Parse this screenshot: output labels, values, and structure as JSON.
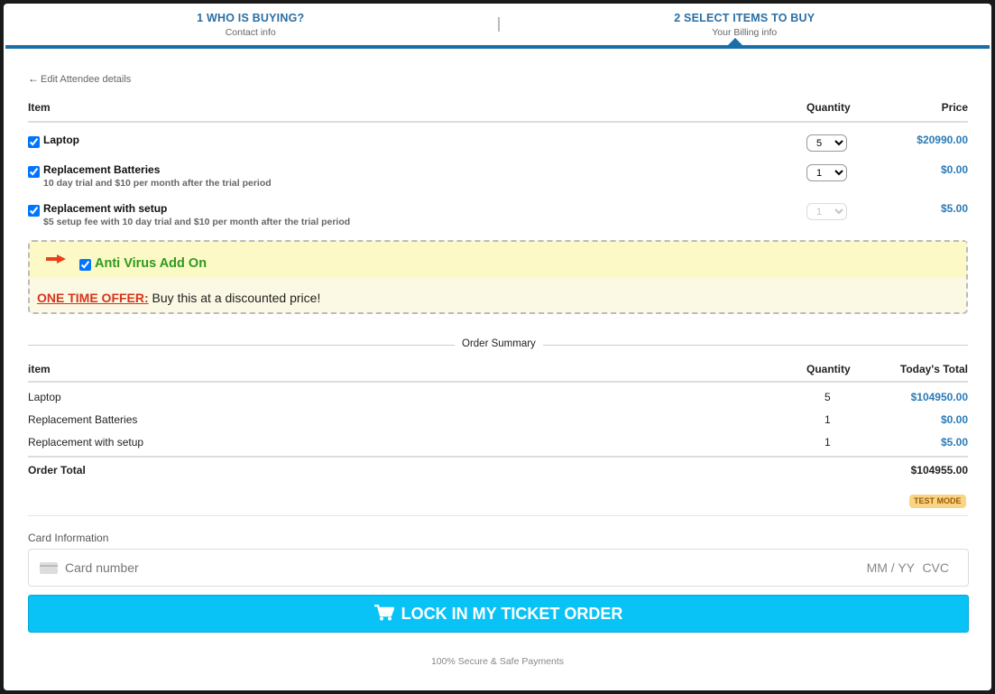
{
  "steps": [
    {
      "title": "1 WHO IS BUYING?",
      "sub": "Contact info"
    },
    {
      "title": "2 SELECT ITEMS TO BUY",
      "sub": "Your Billing info"
    }
  ],
  "back_link": "Edit Attendee details",
  "items_table": {
    "headers": {
      "item": "Item",
      "quantity": "Quantity",
      "price": "Price"
    },
    "rows": [
      {
        "name": "Laptop",
        "desc": "",
        "qty": "5",
        "price": "$20990.00",
        "checked": true
      },
      {
        "name": "Replacement Batteries",
        "desc": "10 day trial and $10 per month after the trial period",
        "qty": "1",
        "price": "$0.00",
        "checked": true
      },
      {
        "name": "Replacement with setup",
        "desc": "$5 setup fee with 10 day trial and $10 per month after the trial period",
        "qty": "1",
        "price": "$5.00",
        "checked": true
      }
    ]
  },
  "offer": {
    "title": "Anti Virus Add On",
    "hot_label": "ONE TIME OFFER:",
    "text": " Buy this at a discounted price!"
  },
  "summary": {
    "label": "Order Summary",
    "headers": {
      "item": "item",
      "quantity": "Quantity",
      "total": "Today's Total"
    },
    "rows": [
      {
        "name": "Laptop",
        "qty": "5",
        "total": "$104950.00"
      },
      {
        "name": "Replacement Batteries",
        "qty": "1",
        "total": "$0.00"
      },
      {
        "name": "Replacement with setup",
        "qty": "1",
        "total": "$5.00"
      }
    ],
    "order_total_label": "Order Total",
    "order_total": "$104955.00",
    "mode_badge": "TEST MODE"
  },
  "card": {
    "label": "Card Information",
    "placeholder": "Card number",
    "exp_placeholder": "MM / YY",
    "cvc_placeholder": "CVC"
  },
  "cta_label": "LOCK IN MY TICKET ORDER",
  "secure_text": "100% Secure & Safe Payments",
  "colors": {
    "accent": "#1a6ea8",
    "price": "#2a7ab7",
    "cta": "#09c3f7",
    "offer_title": "#2e9a1c",
    "hot": "#d8341a"
  }
}
